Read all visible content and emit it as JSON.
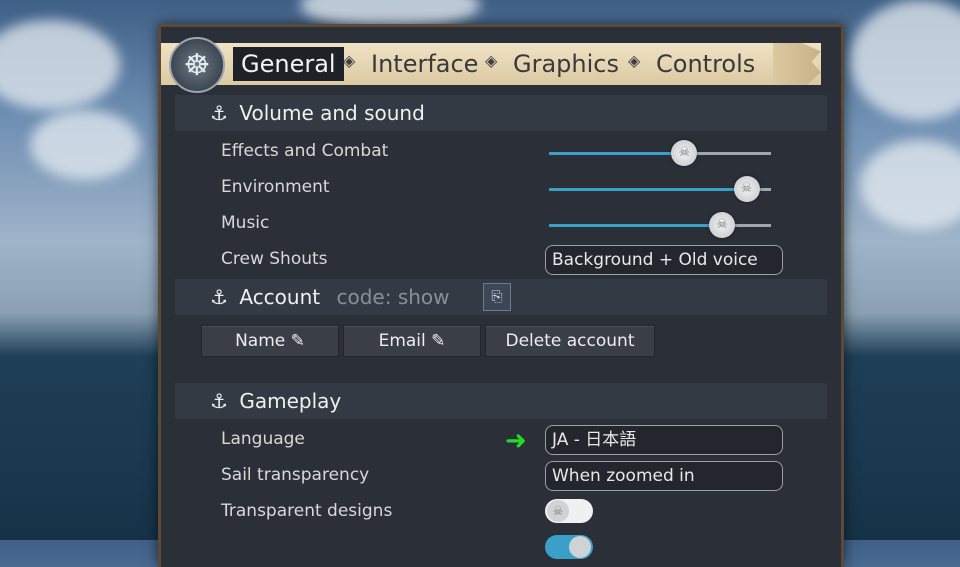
{
  "tabs": [
    {
      "label": "General",
      "active": true
    },
    {
      "label": "Interface",
      "active": false
    },
    {
      "label": "Graphics",
      "active": false
    },
    {
      "label": "Controls",
      "active": false
    }
  ],
  "icons": {
    "menu": "ship-wheel-icon",
    "section": "anchor-icon",
    "separator": "diamond-icon",
    "copy": "copy-icon",
    "edit": "pencil-icon",
    "arrow": "arrow-right-icon"
  },
  "volume": {
    "title": "Volume and sound",
    "effects": {
      "label": "Effects and Combat",
      "value": 0.61
    },
    "environment": {
      "label": "Environment",
      "value": 0.89
    },
    "music": {
      "label": "Music",
      "value": 0.78
    },
    "crew_shouts": {
      "label": "Crew Shouts",
      "value": "Background + Old voice"
    }
  },
  "account": {
    "title": "Account",
    "code_label": "code: show",
    "name_button": "Name ✎",
    "email_button": "Email ✎",
    "delete_button": "Delete account"
  },
  "gameplay": {
    "title": "Gameplay",
    "language": {
      "label": "Language",
      "value": "JA - 日本語"
    },
    "sail_transparency": {
      "label": "Sail transparency",
      "value": "When zoomed in"
    },
    "transparent_designs": {
      "label": "Transparent designs",
      "enabled": false
    }
  },
  "colors": {
    "accent": "#3aa0c8",
    "arrow": "#22dd22"
  }
}
